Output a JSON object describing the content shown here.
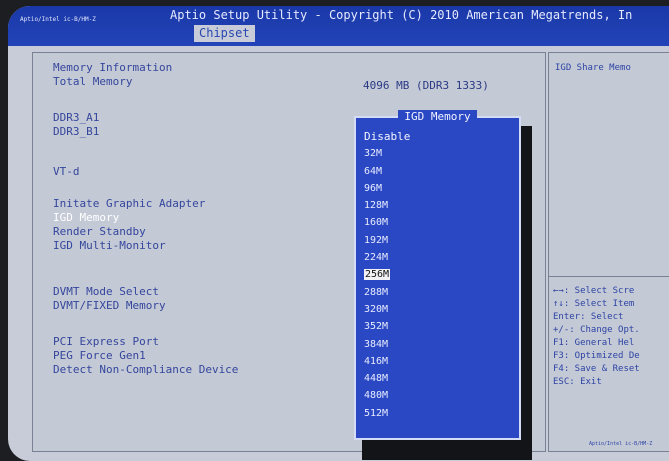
{
  "titlebar": {
    "id_text": "Aptio/Intel ic-B/HM-Z",
    "title": "Aptio Setup Utility - Copyright (C) 2010 American Megatrends, In",
    "tab": "Chipset"
  },
  "main": {
    "memory_info_label": "Memory Information",
    "total_memory_label": "Total Memory",
    "total_memory_value": "4096 MB (DDR3 1333)",
    "ddr3_a1_label": "DDR3_A1",
    "ddr3_b1_label": "DDR3_B1",
    "vtd_label": "VT-d",
    "initiate_graphic_label": "Initate Graphic Adapter",
    "igd_memory_label": "IGD Memory",
    "render_standby_label": "Render Standby",
    "igd_multi_monitor_label": "IGD Multi-Monitor",
    "dvmt_mode_label": "DVMT Mode Select",
    "dvmt_fixed_label": "DVMT/FIXED Memory",
    "pci_express_label": "PCI Express Port",
    "peg_force_label": "PEG Force Gen1",
    "detect_noncompliance_label": "Detect Non-Compliance Device"
  },
  "popup": {
    "title": "IGD Memory",
    "options": [
      "Disable",
      "32M",
      "64M",
      "96M",
      "128M",
      "160M",
      "192M",
      "224M",
      "256M",
      "288M",
      "320M",
      "352M",
      "384M",
      "416M",
      "448M",
      "480M",
      "512M"
    ],
    "selected": "256M"
  },
  "side": {
    "help_text": "IGD Share Memo",
    "keys": [
      "←→: Select Scre",
      "↑↓: Select Item",
      "Enter: Select",
      "+/-: Change Opt.",
      "F1: General Hel",
      "F3: Optimized De",
      "F4: Save & Reset",
      "ESC: Exit"
    ],
    "footer": "Aptio/Intel ic-B/HM-Z"
  }
}
